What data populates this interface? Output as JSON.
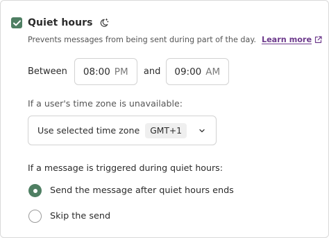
{
  "header": {
    "title": "Quiet hours",
    "checkbox_checked": true,
    "icon": "moon-stars-icon"
  },
  "description": {
    "text": "Prevents messages from being sent during part of the day.",
    "link_label": "Learn more",
    "link_icon": "external-link-icon"
  },
  "schedule": {
    "between_label": "Between",
    "start_time": "08:00",
    "start_ampm": "PM",
    "and_label": "and",
    "end_time": "09:00",
    "end_ampm": "AM"
  },
  "timezone": {
    "label": "If a user's time zone is unavailable:",
    "selected_option": "Use selected time zone",
    "badge": "GMT+1",
    "icon": "chevron-down-icon"
  },
  "trigger": {
    "label": "If a message is triggered during quiet hours:",
    "options": [
      {
        "label": "Send the message after quiet hours ends",
        "selected": true
      },
      {
        "label": "Skip the send",
        "selected": false
      }
    ]
  },
  "colors": {
    "accent_green": "#4f7f63",
    "link_purple": "#6d3a8c",
    "border_gray": "#d2d2d2"
  }
}
